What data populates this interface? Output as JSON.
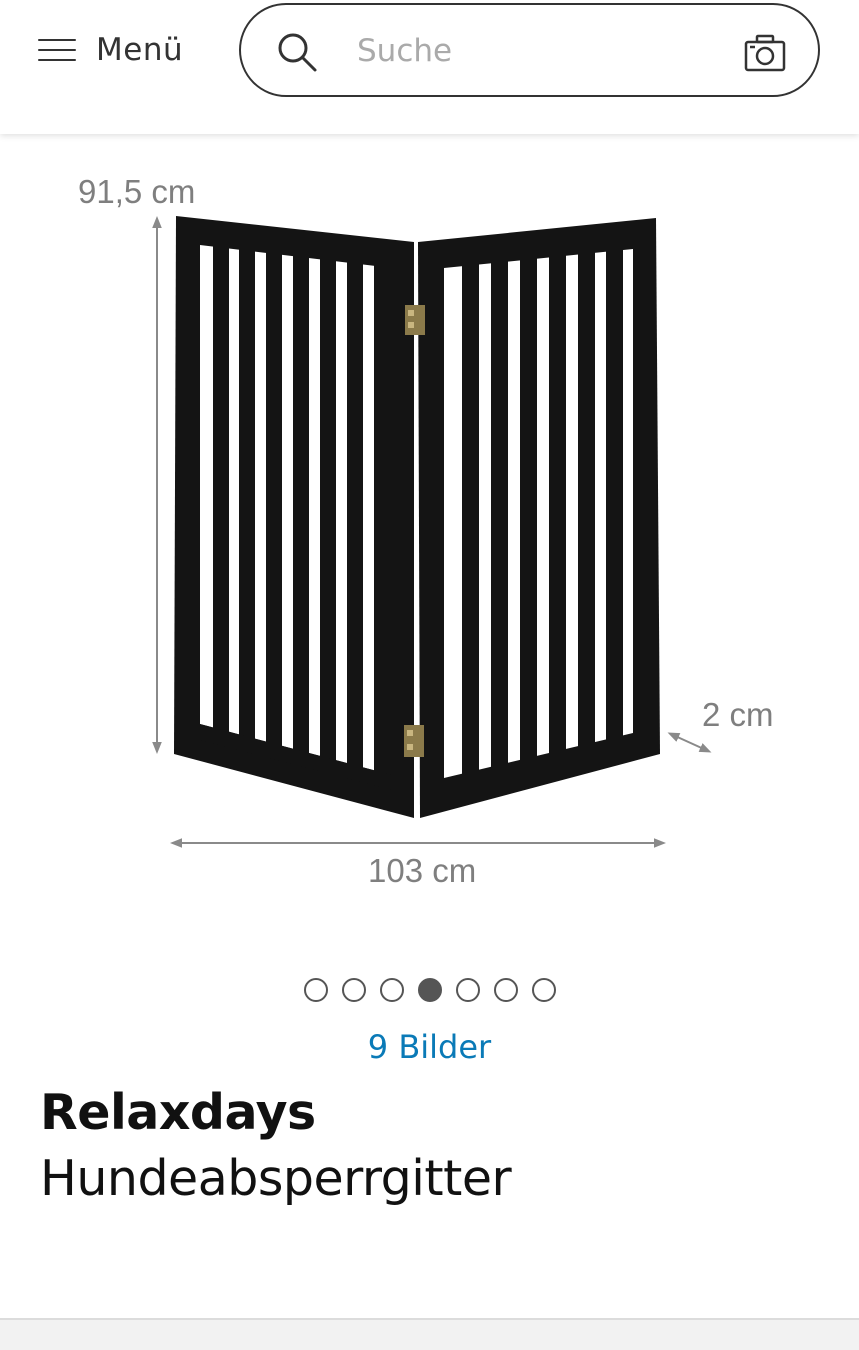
{
  "header": {
    "menu_label": "Menü",
    "search_placeholder": "Suche",
    "icons": [
      "hamburger-icon",
      "search-icon",
      "camera-icon"
    ]
  },
  "product_image": {
    "dimensions": {
      "height": "91,5 cm",
      "depth": "2 cm",
      "width": "103 cm"
    },
    "gate_color": "#141414"
  },
  "gallery": {
    "total_dots": 7,
    "active_index": 3,
    "images_label": "9 Bilder"
  },
  "product": {
    "brand": "Relaxdays",
    "name": "Hundeabsperrgitter"
  },
  "colors": {
    "link": "#0a7ab7",
    "text": "#111111",
    "dimension_text": "#7f7f7f"
  }
}
